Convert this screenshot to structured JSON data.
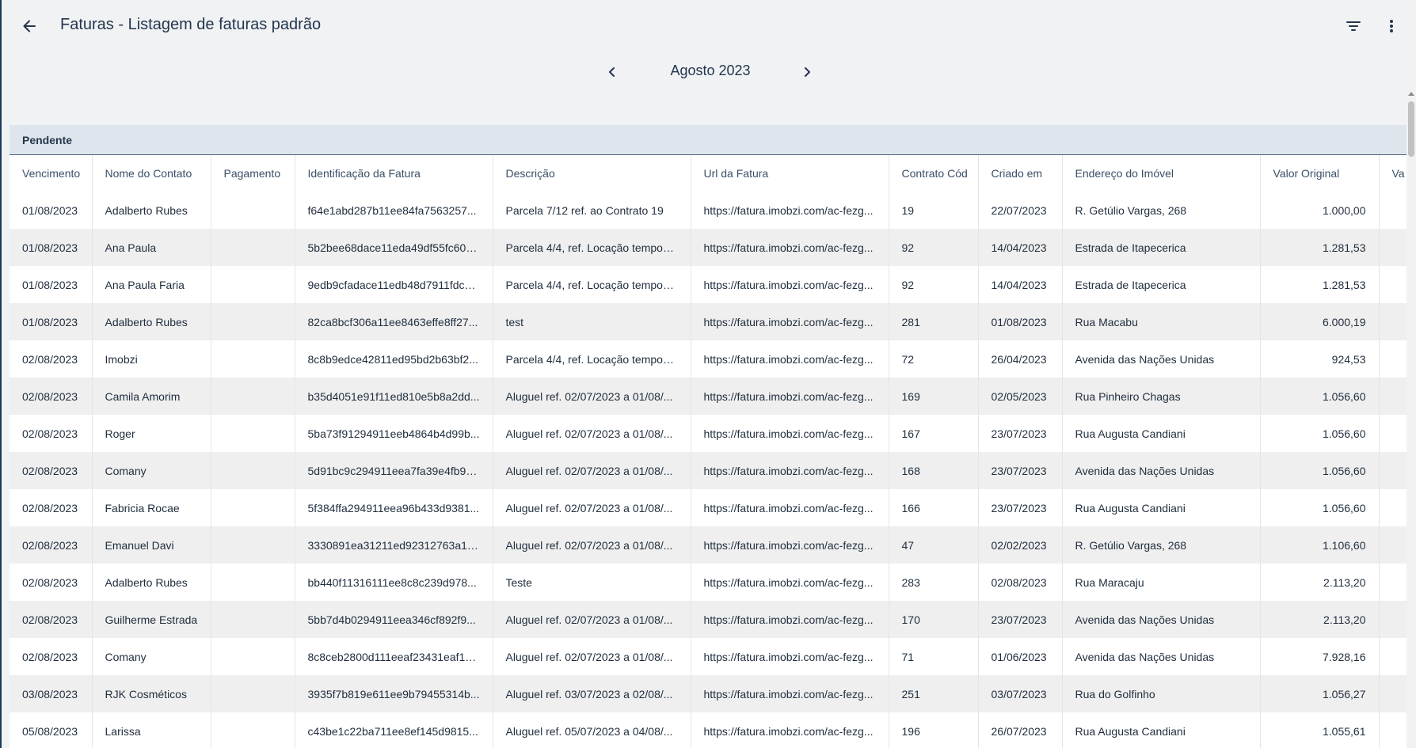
{
  "header": {
    "title": "Faturas - Listagem de faturas padrão",
    "back_icon": "arrow-left-icon",
    "filter_icon": "filter-icon",
    "more_icon": "more-vertical-icon"
  },
  "month_nav": {
    "label": "Agosto 2023",
    "prev_icon": "chevron-left-icon",
    "next_icon": "chevron-right-icon"
  },
  "table": {
    "group_label": "Pendente",
    "columns": [
      "Vencimento",
      "Nome do Contato",
      "Pagamento",
      "Identificação da Fatura",
      "Descrição",
      "Url da Fatura",
      "Contrato Cód",
      "Criado em",
      "Endereço do Imóvel",
      "Valor Original",
      "Va"
    ],
    "rows": [
      [
        "01/08/2023",
        "Adalberto Rubes",
        "",
        "f64e1abd287b11ee84fa7563257...",
        "Parcela 7/12 ref. ao Contrato 19",
        "https://fatura.imobzi.com/ac-fezg...",
        "19",
        "22/07/2023",
        "R. Getúlio Vargas, 268",
        "1.000,00",
        ""
      ],
      [
        "01/08/2023",
        "Ana Paula",
        "",
        "5b2bee68dace11eda49df55fc604...",
        "Parcela 4/4, ref. Locação tempora...",
        "https://fatura.imobzi.com/ac-fezg...",
        "92",
        "14/04/2023",
        "Estrada de Itapecerica",
        "1.281,53",
        ""
      ],
      [
        "01/08/2023",
        "Ana Paula Faria",
        "",
        "9edb9cfadace11edb48d7911fdc5...",
        "Parcela 4/4, ref. Locação tempora...",
        "https://fatura.imobzi.com/ac-fezg...",
        "92",
        "14/04/2023",
        "Estrada de Itapecerica",
        "1.281,53",
        ""
      ],
      [
        "01/08/2023",
        "Adalberto Rubes",
        "",
        "82ca8bcf306a11ee8463effe8ff27...",
        "test",
        "https://fatura.imobzi.com/ac-fezg...",
        "281",
        "01/08/2023",
        "Rua Macabu",
        "6.000,19",
        ""
      ],
      [
        "02/08/2023",
        "Imobzi",
        "",
        "8c8b9edce42811ed95bd2b63bf2...",
        "Parcela 4/4, ref. Locação tempora...",
        "https://fatura.imobzi.com/ac-fezg...",
        "72",
        "26/04/2023",
        "Avenida das Nações Unidas",
        "924,53",
        ""
      ],
      [
        "02/08/2023",
        "Camila Amorim",
        "",
        "b35d4051e91f11ed810e5b8a2dd...",
        "Aluguel ref. 02/07/2023 a 01/08/...",
        "https://fatura.imobzi.com/ac-fezg...",
        "169",
        "02/05/2023",
        "Rua Pinheiro Chagas",
        "1.056,60",
        ""
      ],
      [
        "02/08/2023",
        "Roger",
        "",
        "5ba73f91294911eeb4864b4d99b...",
        "Aluguel ref. 02/07/2023 a 01/08/...",
        "https://fatura.imobzi.com/ac-fezg...",
        "167",
        "23/07/2023",
        "Rua Augusta Candiani",
        "1.056,60",
        ""
      ],
      [
        "02/08/2023",
        "Comany",
        "",
        "5d91bc9c294911eea7fa39e4fb90...",
        "Aluguel ref. 02/07/2023 a 01/08/...",
        "https://fatura.imobzi.com/ac-fezg...",
        "168",
        "23/07/2023",
        "Avenida das Nações Unidas",
        "1.056,60",
        ""
      ],
      [
        "02/08/2023",
        "Fabricia Rocae",
        "",
        "5f384ffa294911eea96b433d9381...",
        "Aluguel ref. 02/07/2023 a 01/08/...",
        "https://fatura.imobzi.com/ac-fezg...",
        "166",
        "23/07/2023",
        "Rua Augusta Candiani",
        "1.056,60",
        ""
      ],
      [
        "02/08/2023",
        "Emanuel Davi",
        "",
        "3330891ea31211ed92312763a13...",
        "Aluguel ref. 02/07/2023 a 01/08/...",
        "https://fatura.imobzi.com/ac-fezg...",
        "47",
        "02/02/2023",
        "R. Getúlio Vargas, 268",
        "1.106,60",
        ""
      ],
      [
        "02/08/2023",
        "Adalberto Rubes",
        "",
        "bb440f11316111ee8c8c239d978...",
        "Teste",
        "https://fatura.imobzi.com/ac-fezg...",
        "283",
        "02/08/2023",
        "Rua Maracaju",
        "2.113,20",
        ""
      ],
      [
        "02/08/2023",
        "Guilherme Estrada",
        "",
        "5bb7d4b0294911eea346cf892f9...",
        "Aluguel ref. 02/07/2023 a 01/08/...",
        "https://fatura.imobzi.com/ac-fezg...",
        "170",
        "23/07/2023",
        "Avenida das Nações Unidas",
        "2.113,20",
        ""
      ],
      [
        "02/08/2023",
        "Comany",
        "",
        "8c8ceb2800d111eeaf23431eaf16...",
        "Aluguel ref. 02/07/2023 a 01/08/...",
        "https://fatura.imobzi.com/ac-fezg...",
        "71",
        "01/06/2023",
        "Avenida das Nações Unidas",
        "7.928,16",
        ""
      ],
      [
        "03/08/2023",
        "RJK Cosméticos",
        "",
        "3935f7b819e611ee9b79455314b...",
        "Aluguel ref. 03/07/2023 a 02/08/...",
        "https://fatura.imobzi.com/ac-fezg...",
        "251",
        "03/07/2023",
        "Rua do Golfinho",
        "1.056,27",
        ""
      ],
      [
        "05/08/2023",
        "Larissa",
        "",
        "c43be1c22ba711ee8ef145d9815...",
        "Aluguel ref. 05/07/2023 a 04/08/...",
        "https://fatura.imobzi.com/ac-fezg...",
        "196",
        "26/07/2023",
        "Rua Augusta Candiani",
        "1.055,61",
        ""
      ]
    ]
  }
}
